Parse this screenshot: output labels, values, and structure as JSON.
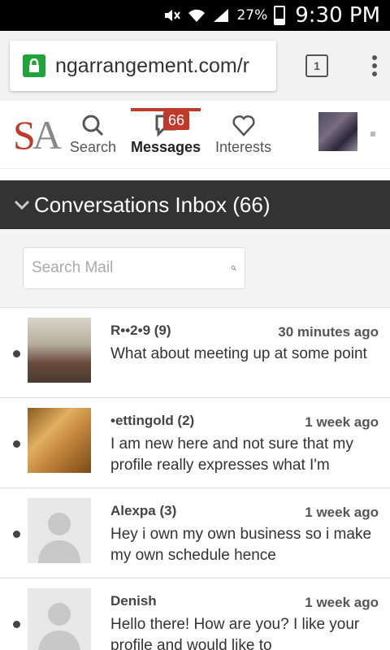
{
  "status": {
    "battery_pct": "27%",
    "time": "9:30 PM"
  },
  "browser": {
    "url": "ngarrangement.com/r",
    "tab_count": "1"
  },
  "nav": {
    "logo_s": "S",
    "logo_a": "A",
    "search_label": "Search",
    "messages_label": "Messages",
    "messages_badge": "66",
    "interests_label": "Interests"
  },
  "inbox": {
    "title": "Conversations Inbox (66)"
  },
  "search": {
    "placeholder": "Search Mail"
  },
  "messages": [
    {
      "name": "R••2•9 (9)",
      "time": "30 minutes ago",
      "preview": "What about meeting up at some point",
      "thumb": "photo1"
    },
    {
      "name": "•ettingold (2)",
      "time": "1 week ago",
      "preview": "I am new here and not sure that my profile really expresses what I'm",
      "thumb": "photo2"
    },
    {
      "name": "Alexpa (3)",
      "time": "1 week ago",
      "preview": "Hey i own my own business so i make my own schedule hence",
      "thumb": "default"
    },
    {
      "name": "Denish",
      "time": "1 week ago",
      "preview": "Hello there! How are you? I like your profile and would like to",
      "thumb": "default"
    }
  ]
}
